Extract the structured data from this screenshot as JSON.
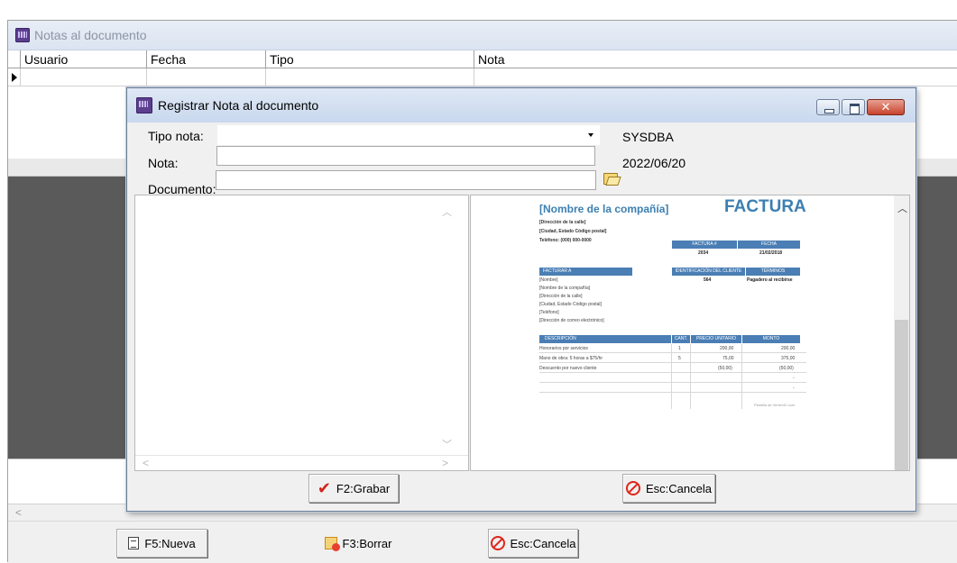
{
  "outer": {
    "title": "Notas al documento",
    "columns": [
      "Usuario",
      "Fecha",
      "Tipo",
      "Nota"
    ],
    "buttons": {
      "new": "F5:Nueva",
      "delete": "F3:Borrar",
      "cancel": "Esc:Cancela"
    }
  },
  "dialog": {
    "title": "Registrar Nota al documento",
    "close_glyph": "✕",
    "labels": {
      "tipo": "Tipo nota:",
      "nota": "Nota:",
      "documento": "Documento:"
    },
    "values": {
      "tipo": "",
      "nota": "",
      "documento": ""
    },
    "user": "SYSDBA",
    "date": "2022/06/20",
    "buttons": {
      "save": "F2:Grabar",
      "cancel": "Esc:Cancela"
    }
  },
  "invoice_preview": {
    "company": "[Nombre de la compañía]",
    "doc_title": "FACTURA",
    "address_lines": [
      "[Dirección de la calle]",
      "[Ciudad, Estado Código postal]",
      "Teléfono: (000) 000-0000"
    ],
    "invoice_header": [
      "FACTURA #",
      "FECHA"
    ],
    "invoice_values": [
      "2034",
      "21/02/2018"
    ],
    "bill_to_header": "FACTURAR A",
    "bill_to_lines": [
      "[Nombre]",
      "[Nombre de la compañía]",
      "[Dirección de la calle]",
      "[Ciudad, Estado Código postal]",
      "[Teléfono]",
      "[Dirección de correo electrónico]"
    ],
    "client_header": [
      "IDENTIFICACIÓN DEL CLIENTE",
      "TÉRMINOS"
    ],
    "client_values": [
      "564",
      "Pagadero al recibirse"
    ],
    "table_header": [
      "DESCRIPCIÓN",
      "CANT.",
      "PRECIO UNITARIO",
      "MONTO"
    ],
    "rows": [
      [
        "Honorarios por servicios",
        "1",
        "200,00",
        "200,00"
      ],
      [
        "Mano de obra: 5 horas a $75/hr",
        "5",
        "75,00",
        "375,00"
      ],
      [
        "Descuento por nuevo cliente",
        "",
        "(50,00)",
        "(50,00)"
      ],
      [
        "",
        "",
        "",
        "-"
      ],
      [
        "",
        "",
        "",
        "-"
      ]
    ],
    "footer": "Plantilla de Vertex42.com"
  }
}
